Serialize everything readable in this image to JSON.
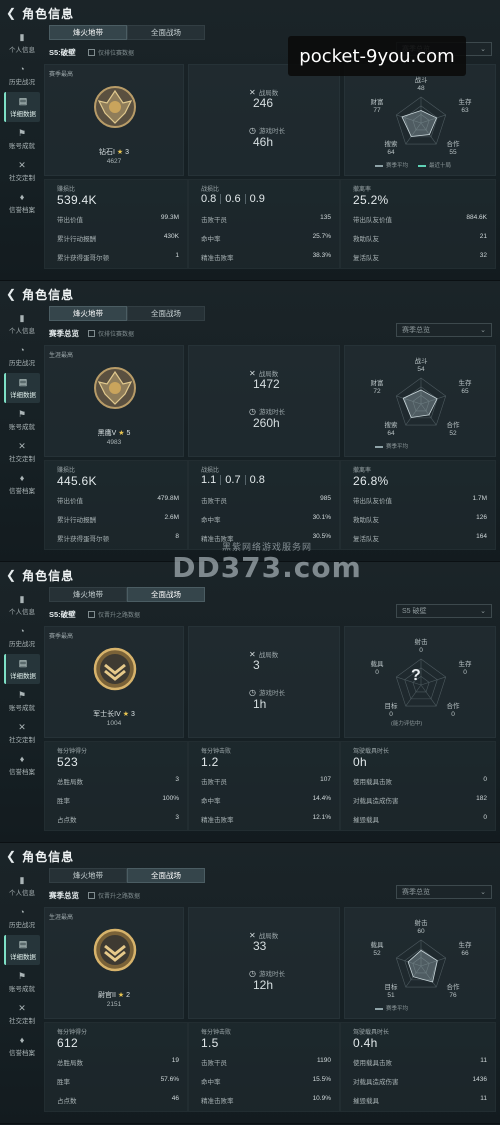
{
  "header": {
    "title": "角色信息"
  },
  "sidebar": [
    "个人信息",
    "历史战况",
    "详细数据",
    "账号成就",
    "社交定制",
    "信誉档案"
  ],
  "tabs": [
    "烽火地带",
    "全面战场"
  ],
  "labels": {
    "season_best": "赛季最高",
    "career_best": "生涯最高",
    "matches": "战局数",
    "playtime": "游戏时长",
    "season_compare": "赛季平均",
    "top10": "最近十局",
    "squad": "(能力评估中)"
  },
  "watermark": {
    "top": "pocket-9you.com",
    "mid_small": "黑紫网络游戏服务网",
    "mid_big": "DD373.com"
  },
  "panels": [
    {
      "season": "S5:破壁",
      "checkbox": "仅排位赛数据",
      "select": "赛季总览",
      "active_tab": 0,
      "best_label": "赛季最高",
      "rank": "钻石I",
      "stars": "3",
      "score": "4627",
      "matches": "246",
      "playtime": "46h",
      "radar_type": "fire",
      "radar": {
        "labels": [
          "战斗",
          "生存",
          "合作",
          "搜索",
          "财富"
        ],
        "values": [
          "48",
          "63",
          "55",
          "64",
          "77"
        ]
      },
      "radar_values_norm": [
        0.48,
        0.63,
        0.55,
        0.64,
        0.77
      ],
      "legend": [
        "赛季平均",
        "最近十局"
      ],
      "stats": [
        {
          "head": "赚损比",
          "big": "539.4K",
          "rows": [
            [
              "带出价值",
              "99.3M"
            ],
            [
              "累计行动报酬",
              "430K"
            ],
            [
              "累计获得蛋哥尔顿",
              "1"
            ]
          ]
        },
        {
          "head": "战损比",
          "kd": [
            "0.8",
            "0.6",
            "0.9"
          ],
          "rows": [
            [
              "击败干员",
              "135"
            ],
            [
              "命中率",
              "25.7%"
            ],
            [
              "精准击败率",
              "38.3%"
            ]
          ]
        },
        {
          "head": "撤离率",
          "big": "25.2%",
          "rows": [
            [
              "带出队友价值",
              "884.6K"
            ],
            [
              "救助队友",
              "21"
            ],
            [
              "复活队友",
              "32"
            ]
          ]
        }
      ]
    },
    {
      "season": "赛季总览",
      "checkbox": "仅排位赛数据",
      "select": "赛季总览",
      "active_tab": 0,
      "best_label": "生涯最高",
      "rank": "黑鹰V",
      "stars": "5",
      "score": "4983",
      "matches": "1472",
      "playtime": "260h",
      "radar_type": "fire",
      "radar": {
        "labels": [
          "战斗",
          "生存",
          "合作",
          "搜索",
          "财富"
        ],
        "values": [
          "54",
          "65",
          "52",
          "64",
          "72"
        ]
      },
      "radar_values_norm": [
        0.54,
        0.65,
        0.52,
        0.64,
        0.72
      ],
      "legend": [
        "赛季平均"
      ],
      "stats": [
        {
          "head": "赚损比",
          "big": "445.6K",
          "rows": [
            [
              "带出价值",
              "479.8M"
            ],
            [
              "累计行动报酬",
              "2.6M"
            ],
            [
              "累计获得蛋哥尔顿",
              "8"
            ]
          ]
        },
        {
          "head": "战损比",
          "kd": [
            "1.1",
            "0.7",
            "0.8"
          ],
          "rows": [
            [
              "击败干员",
              "985"
            ],
            [
              "命中率",
              "30.1%"
            ],
            [
              "精准击败率",
              "30.5%"
            ]
          ]
        },
        {
          "head": "撤离率",
          "big": "26.8%",
          "rows": [
            [
              "带出队友价值",
              "1.7M"
            ],
            [
              "救助队友",
              "126"
            ],
            [
              "复活队友",
              "164"
            ]
          ]
        }
      ]
    },
    {
      "season": "S5:破壁",
      "checkbox": "仅晋升之路数据",
      "select": "S5 破壁",
      "active_tab": 1,
      "best_label": "赛季最高",
      "rank": "军士长IV",
      "stars": "3",
      "score": "1004",
      "matches": "3",
      "playtime": "1h",
      "radar_type": "war",
      "radar": {
        "labels": [
          "射击",
          "生存",
          "合作",
          "目标",
          "载具"
        ],
        "values": [
          "0",
          "0",
          "0",
          "0",
          "0"
        ]
      },
      "radar_values_norm": [
        0,
        0,
        0,
        0,
        0
      ],
      "legend": [],
      "stats": [
        {
          "head": "每分钟得分",
          "big": "523",
          "rows": [
            [
              "总胜局数",
              "3"
            ],
            [
              "胜率",
              "100%"
            ],
            [
              "占点数",
              "3"
            ]
          ]
        },
        {
          "head": "每分钟击败",
          "big": "1.2",
          "rows": [
            [
              "击败干员",
              "107"
            ],
            [
              "命中率",
              "14.4%"
            ],
            [
              "精准击败率",
              "12.1%"
            ]
          ]
        },
        {
          "head": "驾驶载具时长",
          "big": "0h",
          "rows": [
            [
              "使用载具击败",
              "0"
            ],
            [
              "对载具造成伤害",
              "182"
            ],
            [
              "摧毁载具",
              "0"
            ]
          ]
        }
      ]
    },
    {
      "season": "赛季总览",
      "checkbox": "仅晋升之路数据",
      "select": "赛季总览",
      "active_tab": 1,
      "best_label": "生涯最高",
      "rank": "尉官II",
      "stars": "2",
      "score": "2151",
      "matches": "33",
      "playtime": "12h",
      "radar_type": "war",
      "radar": {
        "labels": [
          "射击",
          "生存",
          "合作",
          "目标",
          "载具"
        ],
        "values": [
          "60",
          "66",
          "76",
          "51",
          "52"
        ]
      },
      "radar_values_norm": [
        0.6,
        0.66,
        0.76,
        0.51,
        0.52
      ],
      "legend": [
        "赛季平均"
      ],
      "stats": [
        {
          "head": "每分钟得分",
          "big": "612",
          "rows": [
            [
              "总胜局数",
              "19"
            ],
            [
              "胜率",
              "57.6%"
            ],
            [
              "占点数",
              "46"
            ]
          ]
        },
        {
          "head": "每分钟击败",
          "big": "1.5",
          "rows": [
            [
              "击败干员",
              "1190"
            ],
            [
              "命中率",
              "15.5%"
            ],
            [
              "精准击败率",
              "10.9%"
            ]
          ]
        },
        {
          "head": "驾驶载具时长",
          "big": "0.4h",
          "rows": [
            [
              "使用载具击败",
              "11"
            ],
            [
              "对载具造成伤害",
              "1436"
            ],
            [
              "摧毁载具",
              "11"
            ]
          ]
        }
      ]
    }
  ]
}
